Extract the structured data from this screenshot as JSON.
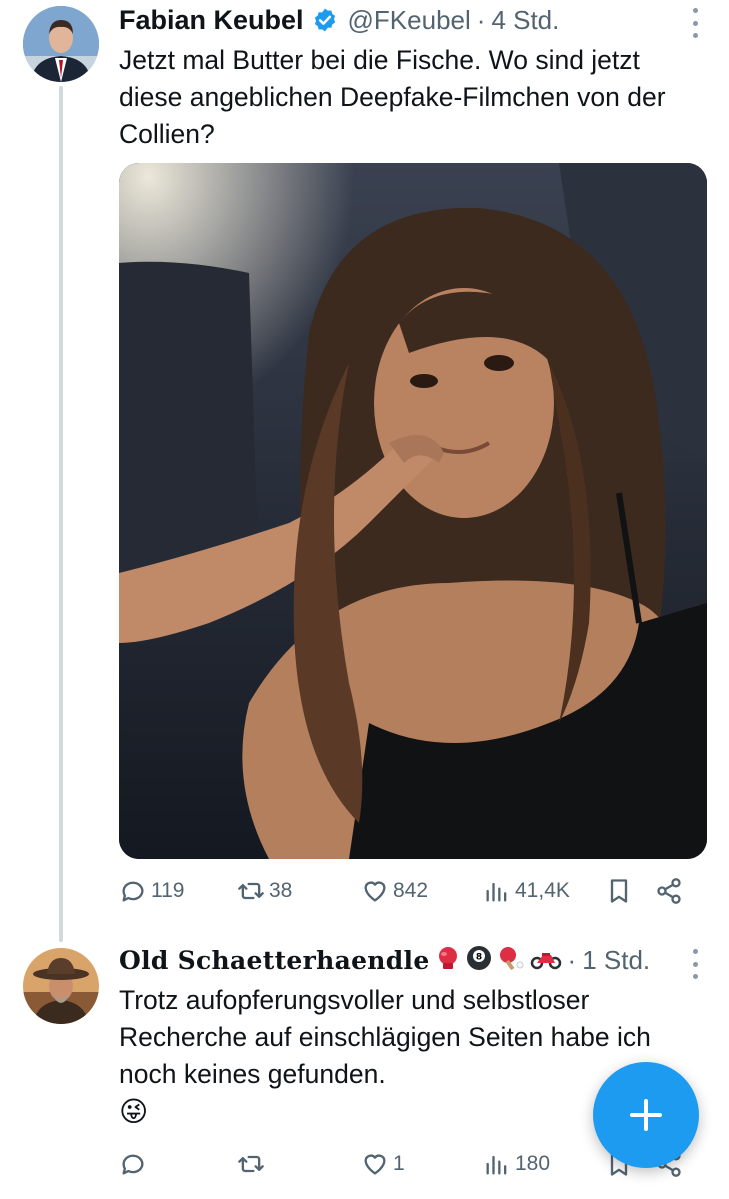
{
  "tweet1": {
    "display_name": "Fabian Keubel",
    "handle": "@FKeubel",
    "separator": "·",
    "time": "4 Std.",
    "text": "Jetzt mal Butter bei die Fische. Wo sind jetzt diese angeblichen Deepfake-Filmchen von der Collien?",
    "stats": {
      "replies": "119",
      "reposts": "38",
      "likes": "842",
      "views": "41,4K"
    }
  },
  "tweet2": {
    "display_name": "Old Schaetterhaendle",
    "separator": "·",
    "time": "1 Std.",
    "text": "Trotz aufopferungsvoller und selbstloser Recherche auf einschlägigen Seiten habe ich noch keines gefunden.",
    "emoji": "😜",
    "stats": {
      "replies": "",
      "reposts": "",
      "likes": "1",
      "views": "180"
    }
  },
  "colors": {
    "accent": "#1d9bf0",
    "secondary_text": "#536471",
    "primary_text": "#0f1419"
  },
  "icons": [
    "verified-badge-icon",
    "more-icon",
    "reply-icon",
    "repost-icon",
    "like-icon",
    "views-icon",
    "bookmark-icon",
    "share-icon",
    "compose-plus-icon",
    "boxing-glove-icon",
    "eight-ball-icon",
    "ping-pong-icon",
    "motorcycle-icon"
  ]
}
